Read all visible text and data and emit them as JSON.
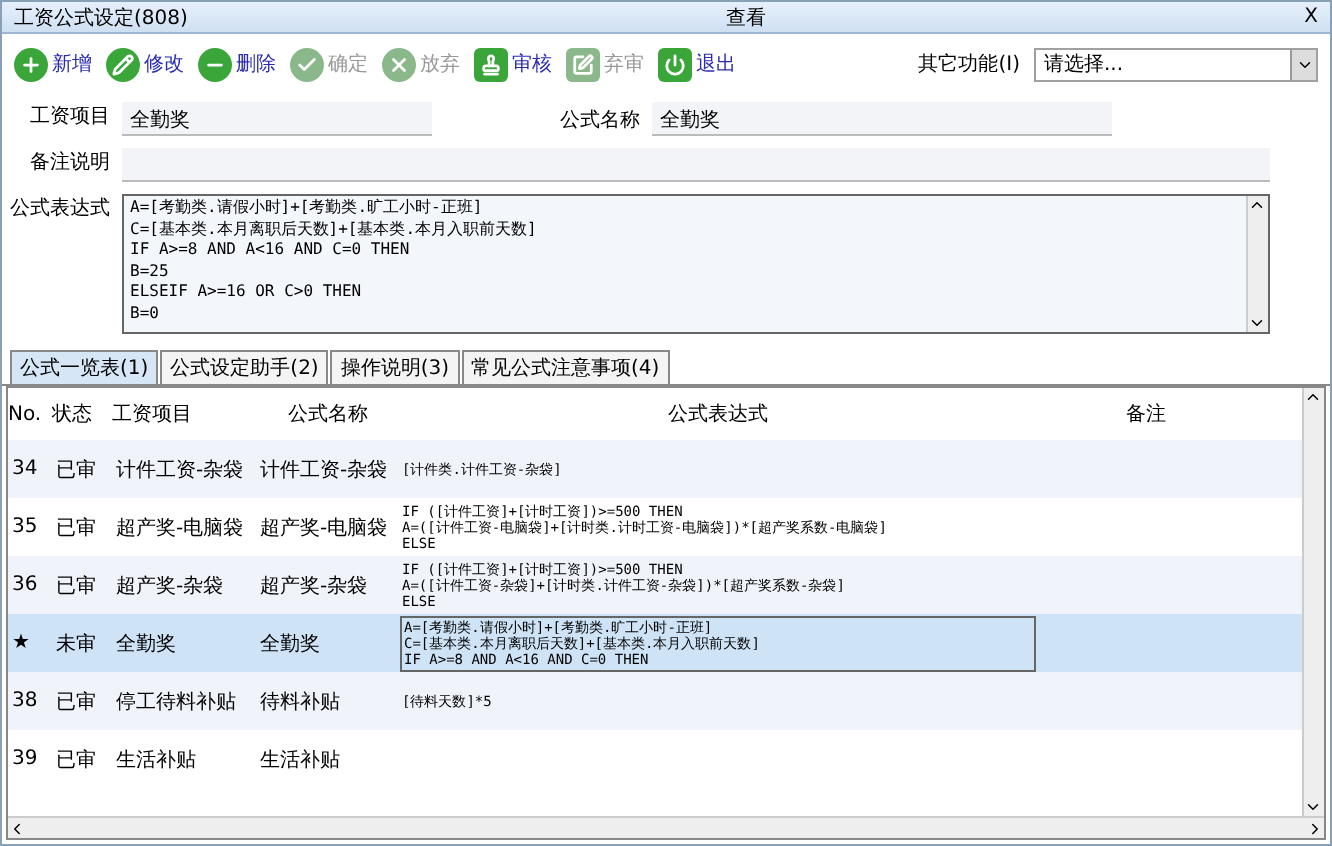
{
  "window": {
    "title": "工资公式设定(808)",
    "mode": "查看",
    "close": "X"
  },
  "toolbar": [
    {
      "label": "新增",
      "kind": "plus",
      "disabled": false
    },
    {
      "label": "修改",
      "kind": "pencil",
      "disabled": false
    },
    {
      "label": "删除",
      "kind": "minus",
      "disabled": false
    },
    {
      "label": "确定",
      "kind": "check",
      "disabled": true
    },
    {
      "label": "放弃",
      "kind": "cross",
      "disabled": true
    },
    {
      "label": "审核",
      "kind": "stamp",
      "disabled": false
    },
    {
      "label": "弃审",
      "kind": "edit",
      "disabled": true
    },
    {
      "label": "退出",
      "kind": "power",
      "disabled": false
    }
  ],
  "other_functions": {
    "label": "其它功能(I)",
    "value": "请选择..."
  },
  "form": {
    "salary_item": {
      "label": "工资项目",
      "value": "全勤奖"
    },
    "formula_name": {
      "label": "公式名称",
      "value": "全勤奖"
    },
    "remark": {
      "label": "备注说明"
    },
    "expression": {
      "label": "公式表达式",
      "lines": [
        "A=[考勤类.请假小时]+[考勤类.旷工小时-正班]",
        "C=[基本类.本月离职后天数]+[基本类.本月入职前天数]",
        "IF A>=8 AND A<16 AND C=0 THEN",
        "B=25",
        "ELSEIF A>=16 OR C>0 THEN",
        "B=0"
      ]
    }
  },
  "tabs": [
    {
      "label": "公式一览表(1)",
      "selected": true
    },
    {
      "label": "公式设定助手(2)",
      "selected": false
    },
    {
      "label": "操作说明(3)",
      "selected": false
    },
    {
      "label": "常见公式注意事项(4)",
      "selected": false
    }
  ],
  "table": {
    "columns": [
      "No.",
      "状态",
      "工资项目",
      "公式名称",
      "公式表达式",
      "备注"
    ],
    "rows": [
      {
        "no": "34",
        "status": "已审",
        "item": "计件工资-杂袋",
        "name": "计件工资-杂袋",
        "formula": "[计件类.计件工资-杂袋]",
        "selected": false
      },
      {
        "no": "35",
        "status": "已审",
        "item": "超产奖-电脑袋",
        "name": "超产奖-电脑袋",
        "formula": "IF ([计件工资]+[计时工资])>=500 THEN\nA=([计件工资-电脑袋]+[计时类.计时工资-电脑袋])*[超产奖系数-电脑袋]\nELSE",
        "selected": false
      },
      {
        "no": "36",
        "status": "已审",
        "item": "超产奖-杂袋",
        "name": "超产奖-杂袋",
        "formula": "IF ([计件工资]+[计时工资])>=500 THEN\nA=([计件工资-杂袋]+[计时类.计件工资-杂袋])*[超产奖系数-杂袋]\nELSE",
        "selected": false
      },
      {
        "no": "★",
        "status": "未审",
        "item": "全勤奖",
        "name": "全勤奖",
        "formula": "A=[考勤类.请假小时]+[考勤类.旷工小时-正班]\nC=[基本类.本月离职后天数]+[基本类.本月入职前天数]\nIF A>=8 AND A<16 AND C=0 THEN",
        "selected": true
      },
      {
        "no": "38",
        "status": "已审",
        "item": "停工待料补贴",
        "name": "待料补贴",
        "formula": "[待料天数]*5",
        "selected": false
      },
      {
        "no": "39",
        "status": "已审",
        "item": "生活补贴",
        "name": "生活补贴",
        "formula": "",
        "selected": false
      }
    ]
  }
}
